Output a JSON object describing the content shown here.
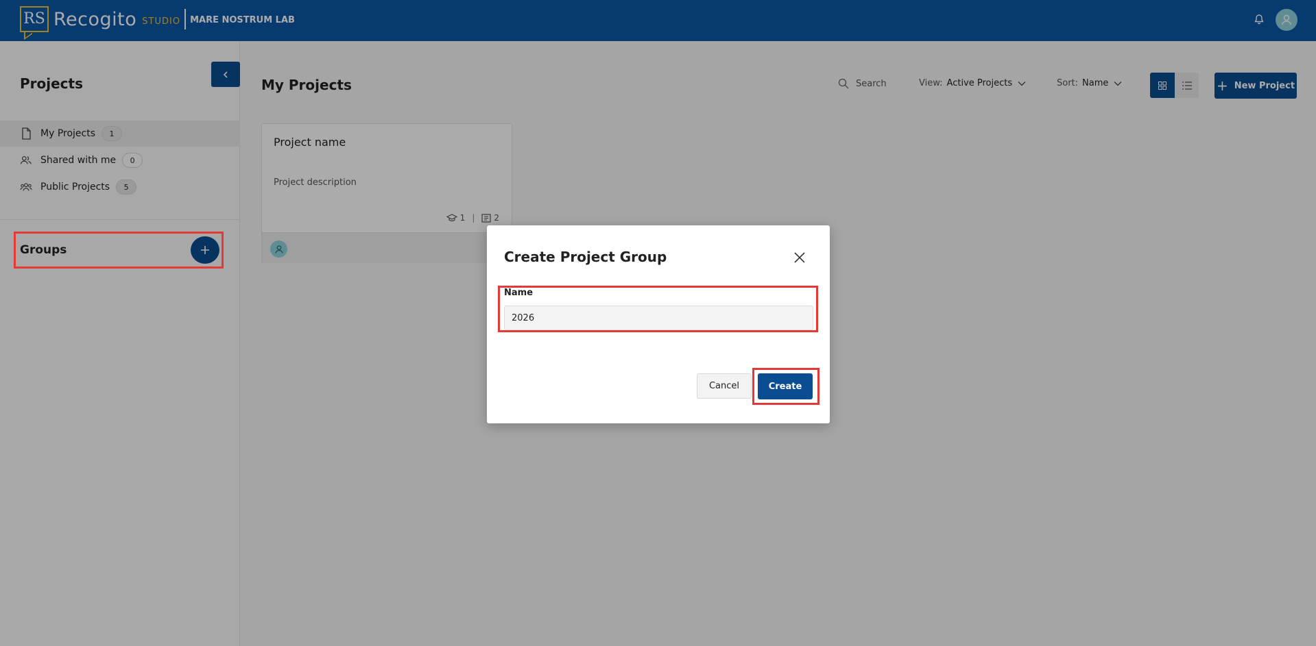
{
  "header": {
    "logo_mark": "RS",
    "app_name": "Recogito",
    "app_suffix": "STUDIO",
    "org_name": "MARE NOSTRUM LAB"
  },
  "sidebar": {
    "title": "Projects",
    "items": [
      {
        "label": "My Projects",
        "count": "1",
        "icon": "document-icon"
      },
      {
        "label": "Shared with me",
        "count": "0",
        "icon": "users-icon"
      },
      {
        "label": "Public Projects",
        "count": "5",
        "icon": "group-icon"
      }
    ],
    "groups_label": "Groups"
  },
  "main": {
    "title": "My Projects",
    "search_label": "Search",
    "view_label": "View:",
    "view_value": "Active Projects",
    "sort_label": "Sort:",
    "sort_value": "Name",
    "new_project_label": "New Project"
  },
  "card": {
    "title": "Project name",
    "description": "Project description",
    "students": "1",
    "documents": "2"
  },
  "modal": {
    "title": "Create Project Group",
    "name_label": "Name",
    "name_value": "2026",
    "cancel_label": "Cancel",
    "create_label": "Create"
  },
  "colors": {
    "brand": "#0b57a4",
    "button": "#0b4d91",
    "accent": "#f2c230",
    "highlight": "#e53935"
  }
}
